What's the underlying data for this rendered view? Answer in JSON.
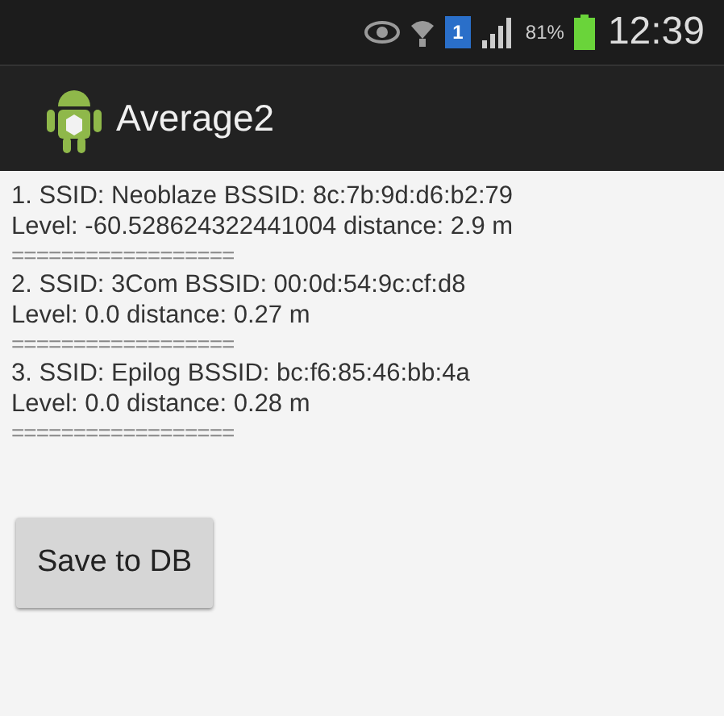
{
  "status_bar": {
    "sim_label": "1",
    "battery": "81%",
    "time": "12:39"
  },
  "action_bar": {
    "title": "Average2"
  },
  "results": [
    {
      "line1": "1. SSID: Neoblaze BSSID: 8c:7b:9d:d6:b2:79",
      "line2": "Level: -60.528624322441004 distance: 2.9 m",
      "separator": "=================="
    },
    {
      "line1": "2. SSID: 3Com BSSID: 00:0d:54:9c:cf:d8",
      "line2": "Level: 0.0 distance: 0.27 m",
      "separator": "=================="
    },
    {
      "line1": "3. SSID: Epilog BSSID: bc:f6:85:46:bb:4a",
      "line2": "Level: 0.0 distance: 0.28 m",
      "separator": "=================="
    }
  ],
  "save_button": "Save to DB"
}
